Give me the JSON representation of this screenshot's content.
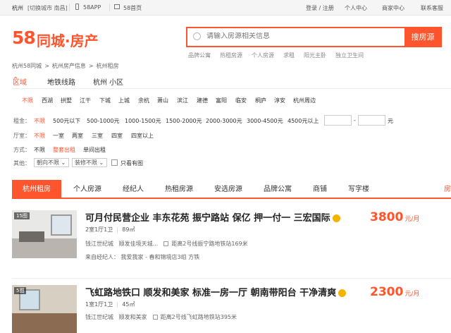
{
  "topbar": {
    "city": "杭州",
    "switch_city": "[切换城市 南昌]",
    "app": "58APP",
    "home": "58首页",
    "login": "登录 / 注册",
    "user_center": "个人中心",
    "merchant_center": "商家中心",
    "contact": "联系客服"
  },
  "logo": {
    "brand": "58",
    "text": "同城·房产"
  },
  "search": {
    "placeholder": "请输入房源相关信息",
    "button": "搜房源"
  },
  "hot_links": [
    "品牌公寓",
    "热租房源",
    "个人房源",
    "求租",
    "阳光主卧",
    "独立卫生间"
  ],
  "breadcrumb": [
    "杭州58同城",
    ">",
    "杭州房产信息",
    ">",
    "杭州租房"
  ],
  "filter_tabs": [
    "区域",
    "地铁线路",
    "杭州 小区"
  ],
  "areas": [
    "不限",
    "西湖",
    "拱墅",
    "江干",
    "下城",
    "上城",
    "余杭",
    "萧山",
    "滨江",
    "建德",
    "富阳",
    "临安",
    "桐庐",
    "淳安",
    "杭州周边"
  ],
  "rent": {
    "label": "租金：",
    "options": [
      "不限",
      "500元以下",
      "500-1000元",
      "1000-1500元",
      "1500-2000元",
      "2000-3000元",
      "3000-4500元",
      "4500元以上"
    ],
    "dash": "-",
    "unit": "元"
  },
  "rooms": {
    "label": "厅室：",
    "options": [
      "不限",
      "一室",
      "两室",
      "三室",
      "四室",
      "四室以上"
    ]
  },
  "method": {
    "label": "方式：",
    "options": [
      "不限",
      "整套出租",
      "单间出租"
    ]
  },
  "other": {
    "label": "其他：",
    "orientation": "朝向不限",
    "decoration": "装修不限",
    "images_only": "只看有图"
  },
  "tabs": [
    "杭州租房",
    "个人房源",
    "经纪人",
    "热租房源",
    "安选房源",
    "品牌公寓",
    "商铺",
    "写字楼",
    "房"
  ],
  "listings": [
    {
      "photos": "15图",
      "title": "可月付民营企业 丰东花苑 振宁路站 保亿 押一付一 三宏国际",
      "rooms": "2室1厅1卫",
      "area": "89㎡",
      "district": "钱江世纪城",
      "community": "顺发佳境天城...",
      "distance": "距离2号线振宁路地铁站169米",
      "agent": "来自经纪人： 我爱我家 - 春和锦境店3组 方铁",
      "price": "3800",
      "unit": "元/月"
    },
    {
      "photos": "5图",
      "title": "飞虹路地铁口 顺发和美家 标准一房一厅 朝南带阳台 干净清爽",
      "rooms": "1室1厅1卫",
      "area": "45㎡",
      "district": "钱江世纪城",
      "community": "顺发和美家",
      "distance": "距离2号线飞虹路地铁站395米",
      "price": "2300",
      "unit": "元/月"
    }
  ]
}
